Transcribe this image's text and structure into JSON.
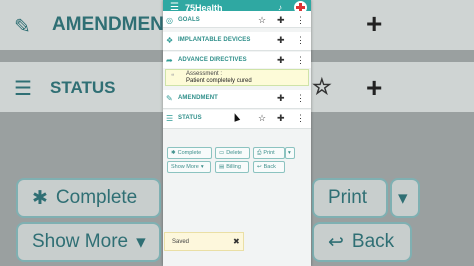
{
  "app": {
    "brand": "75Health",
    "menu_icon": "hamburger-icon",
    "bell_icon": "bell-icon"
  },
  "sections": [
    {
      "label": "GOALS",
      "icon": "target-icon"
    },
    {
      "label": "IMPLANTABLE DEVICES",
      "icon": "device-icon"
    },
    {
      "label": "ADVANCE DIRECTIVES",
      "icon": "share-icon"
    },
    {
      "label": "AMENDMENT",
      "icon": "pencil-icon"
    },
    {
      "label": "STATUS",
      "icon": "list-icon"
    }
  ],
  "assessment": {
    "title": "Assessment :",
    "value": "Patient completely cured"
  },
  "buttons": {
    "complete": "Complete",
    "delete": "Delete",
    "print": "Print",
    "show_more": "Show More",
    "billing": "Billing",
    "back": "Back"
  },
  "background": {
    "amendment": "AMENDMENT",
    "status": "STATUS",
    "complete": "Complete",
    "print": "Print",
    "show_more": "Show More",
    "back": "Back"
  },
  "toast": {
    "message": "Saved"
  },
  "colors": {
    "accent": "#2fa8a2",
    "teal_text": "#2f8f8a"
  }
}
